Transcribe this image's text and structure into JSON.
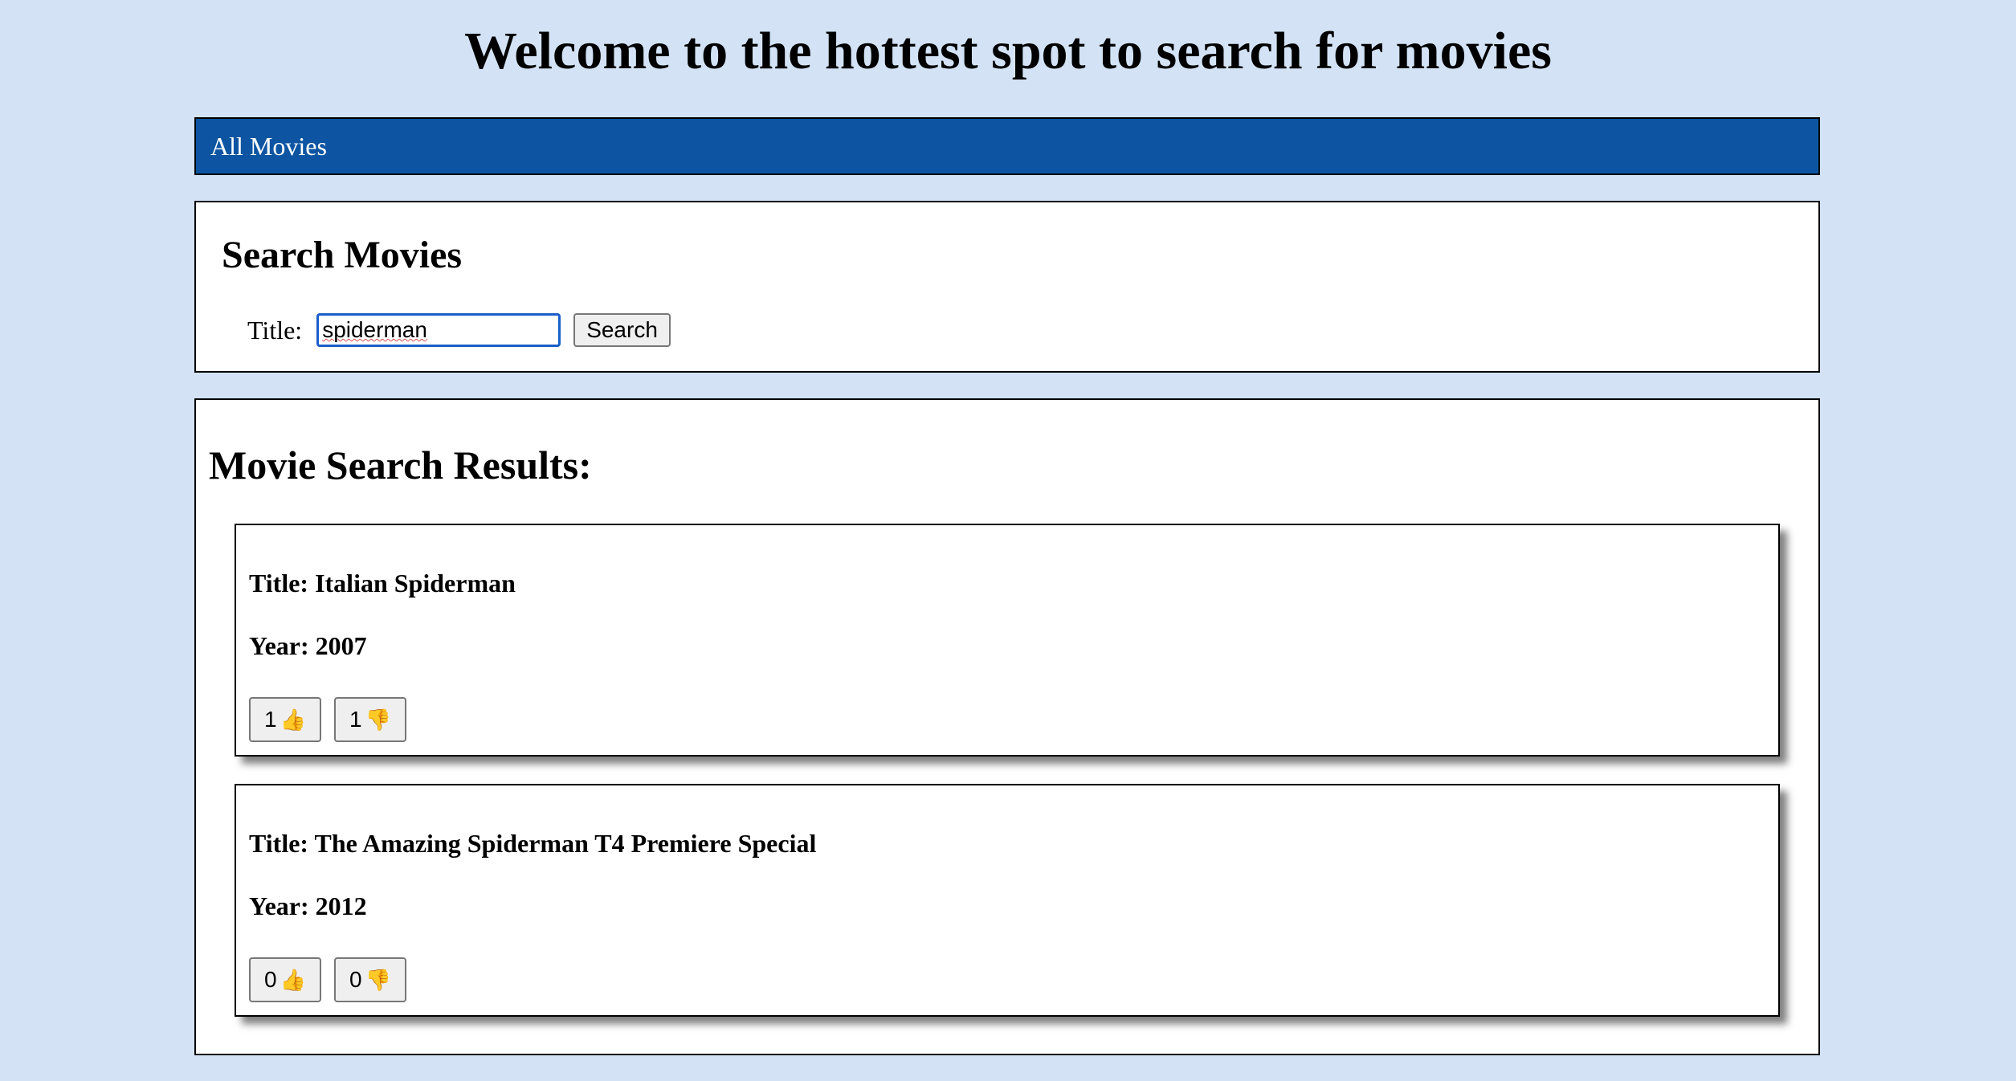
{
  "header": {
    "title": "Welcome to the hottest spot to search for movies"
  },
  "nav": {
    "all_movies_label": "All Movies"
  },
  "search": {
    "heading": "Search Movies",
    "title_label": "Title:",
    "title_value": "spiderman",
    "button_label": "Search"
  },
  "results": {
    "heading": "Movie Search Results:",
    "movies": [
      {
        "title_line": "Title: Italian Spiderman",
        "year_line": "Year: 2007",
        "likes": "1",
        "dislikes": "1"
      },
      {
        "title_line": "Title: The Amazing Spiderman T4 Premiere Special",
        "year_line": "Year: 2012",
        "likes": "0",
        "dislikes": "0"
      }
    ]
  },
  "icons": {
    "like": "thumbs-up-icon",
    "dislike": "thumbs-down-icon"
  },
  "colors": {
    "background": "#d3e3f5",
    "nav": "#0d55a2",
    "input_focus": "#1a5fc9"
  }
}
